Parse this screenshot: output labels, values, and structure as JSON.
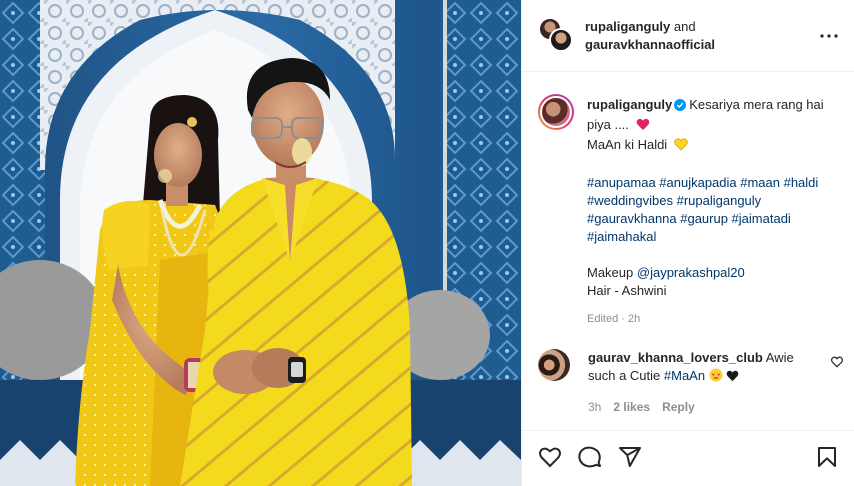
{
  "post": {
    "author_1": "rupaliganguly",
    "and_text": "and",
    "author_2": "gauravkhannaofficial"
  },
  "caption": {
    "username": "rupaliganguly",
    "line1": "Kesariya mera rang hai piya ....",
    "line2": "MaAn ki Haldi",
    "hashtags_1": "#anupamaa #anujkapadia #maan #haldi",
    "hashtags_2": "#weddingvibes #rupaliganguly",
    "hashtags_3": "#gauravkhanna #gaurup #jaimatadi",
    "hashtags_4": "#jaimahakal",
    "makeup_label": "Makeup ",
    "makeup_handle": "@jayprakashpal20",
    "hair": "Hair - Ashwini",
    "edited": "Edited · 2h"
  },
  "comment": {
    "username": "gaurav_khanna_lovers_club",
    "text": "Awie such a Cutie",
    "tag": "#MaAn",
    "time": "3h",
    "likes": "2 likes",
    "reply": "Reply"
  },
  "icons": {
    "more": "more-options-icon",
    "verified": "verified-badge-icon",
    "like": "heart-icon",
    "comment": "comment-icon",
    "share": "share-icon",
    "save": "bookmark-icon"
  },
  "colors": {
    "link": "#00376b",
    "verified": "#0095f6",
    "meta": "#8e8e8e"
  }
}
